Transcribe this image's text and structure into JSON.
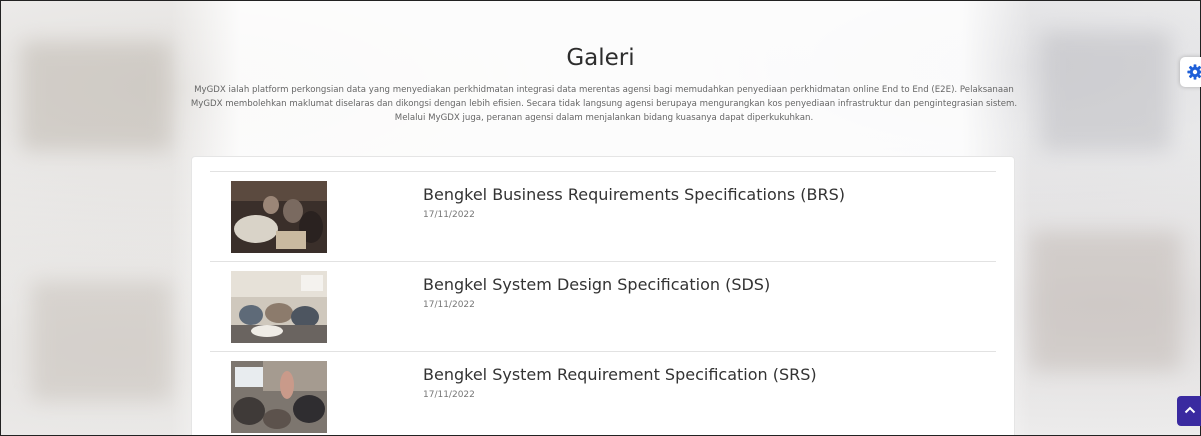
{
  "page": {
    "title": "Galeri",
    "description": "MyGDX ialah platform perkongsian data yang menyediakan perkhidmatan integrasi data merentas agensi bagi memudahkan penyediaan perkhidmatan online End to End (E2E). Pelaksanaan MyGDX membolehkan maklumat diselaras dan dikongsi dengan lebih efisien. Secara tidak langsung agensi berupaya mengurangkan kos penyediaan infrastruktur dan pengintegrasian sistem. Melalui MyGDX juga, peranan agensi dalam menjalankan bidang kuasanya dapat diperkukuhkan."
  },
  "gallery": {
    "items": [
      {
        "title": "Bengkel Business Requirements Specifications (BRS)",
        "date": "17/11/2022"
      },
      {
        "title": "Bengkel System Design Specification (SDS)",
        "date": "17/11/2022"
      },
      {
        "title": "Bengkel System Requirement Specification (SRS)",
        "date": "17/11/2022"
      }
    ]
  },
  "controls": {
    "settings_icon": "gear-icon",
    "scroll_top_icon": "chevron-up-icon"
  },
  "colors": {
    "accent": "#3a2aa0",
    "settings_icon": "#1e5fd8"
  }
}
